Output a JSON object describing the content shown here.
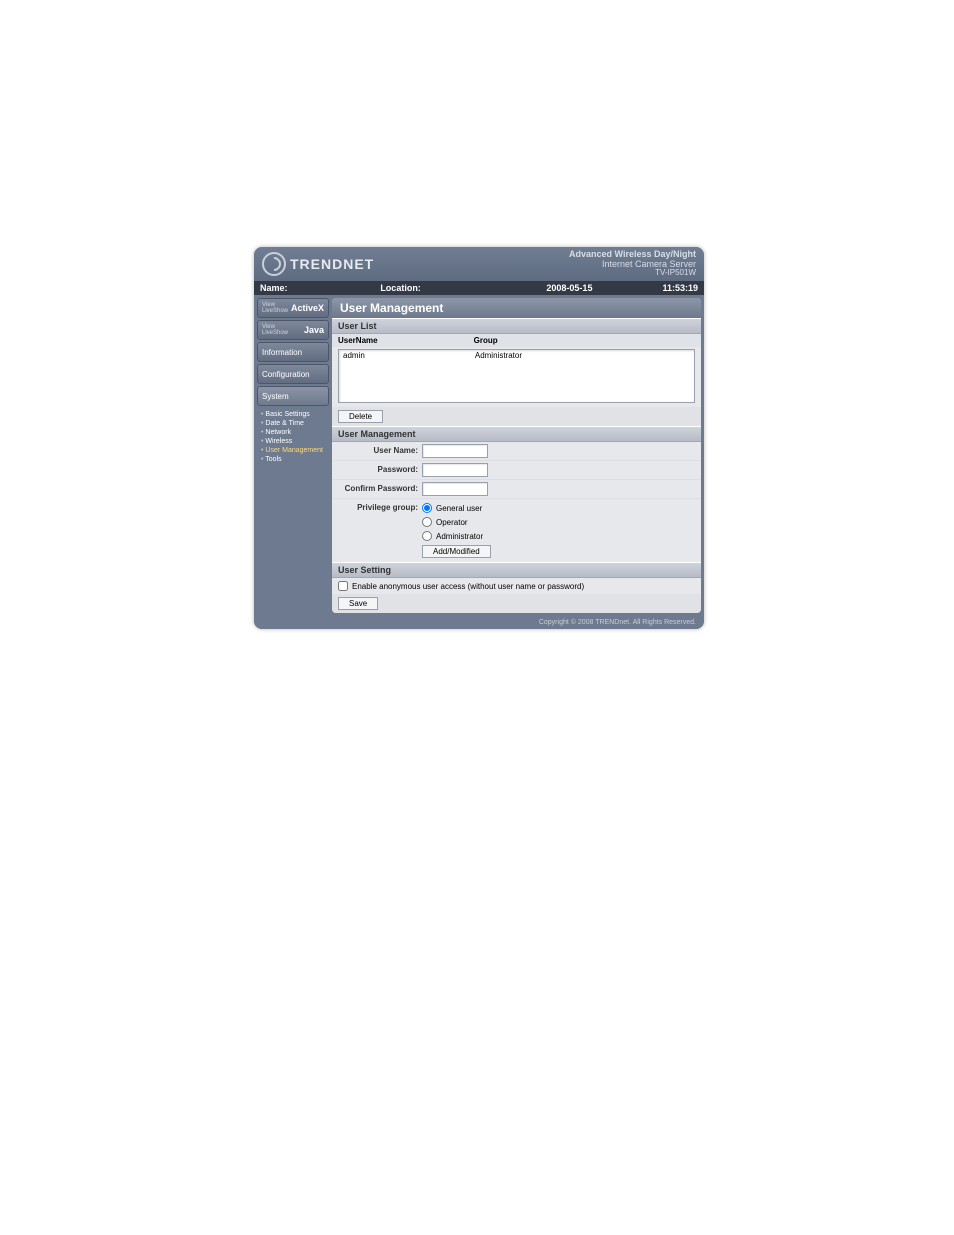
{
  "brand": "TRENDNET",
  "banner": {
    "line1": "Advanced Wireless Day/Night",
    "line2": "Internet Camera Server",
    "line3": "TV-IP501W"
  },
  "infobar": {
    "name_label": "Name:",
    "location_label": "Location:",
    "date": "2008-05-15",
    "time": "11:53:19"
  },
  "sidebar": {
    "view_tiny": "View\nLiveShow",
    "activex": "ActiveX",
    "java": "Java",
    "information": "Information",
    "configuration": "Configuration",
    "system": "System",
    "system_items": [
      "Basic Settings",
      "Date & Time",
      "Network",
      "Wireless",
      "User Management",
      "Tools"
    ]
  },
  "page": {
    "title": "User Management",
    "user_list_header": "User List",
    "col_username": "UserName",
    "col_group": "Group",
    "rows": [
      {
        "user": "admin",
        "group": "Administrator"
      }
    ],
    "delete_btn": "Delete",
    "user_mgmt_header": "User Management",
    "form": {
      "username_label": "User Name:",
      "password_label": "Password:",
      "confirm_label": "Confirm Password:",
      "privilege_label": "Privilege group:",
      "opt_general": "General user",
      "opt_operator": "Operator",
      "opt_admin": "Administrator",
      "add_btn": "Add/Modified"
    },
    "user_setting_header": "User Setting",
    "anon_label": "Enable anonymous user access (without user name or password)",
    "save_btn": "Save"
  },
  "footer": "Copyright © 2008 TRENDnet. All Rights Reserved."
}
